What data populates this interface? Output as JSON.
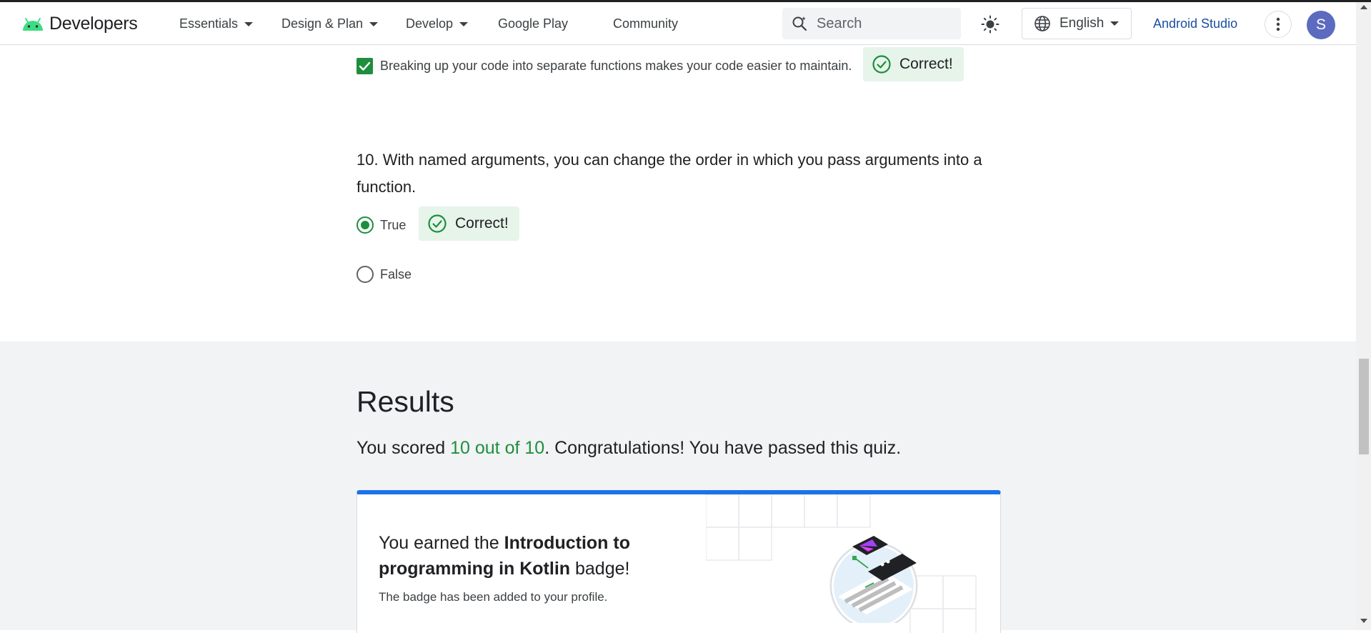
{
  "header": {
    "brand": "Developers",
    "nav": [
      {
        "label": "Essentials",
        "has_menu": true
      },
      {
        "label": "Design & Plan",
        "has_menu": true
      },
      {
        "label": "Develop",
        "has_menu": true
      },
      {
        "label": "Google Play",
        "has_menu": false
      },
      {
        "label": "Community",
        "has_menu": false
      }
    ],
    "search_placeholder": "Search",
    "language": "English",
    "cta": "Android Studio",
    "avatar_initial": "S"
  },
  "quiz": {
    "prev_option_text": "Breaking up your code into separate functions makes your code easier to maintain.",
    "prev_feedback": "Correct!",
    "question": {
      "number": "10.",
      "text": "With named arguments, you can change the order in which you pass arguments into a function.",
      "options": [
        {
          "label": "True",
          "selected": true,
          "feedback": "Correct!"
        },
        {
          "label": "False",
          "selected": false
        }
      ]
    }
  },
  "results": {
    "title": "Results",
    "score_prefix": "You scored ",
    "score": "10 out of 10",
    "score_suffix": ". Congratulations! You have passed this quiz.",
    "badge": {
      "earned_prefix": "You earned the ",
      "badge_name": "Introduction to programming in Kotlin",
      "earned_suffix": " badge!",
      "note": "The badge has been added to your profile."
    }
  },
  "colors": {
    "success": "#1e8e3e",
    "success_bg": "#e6f4ea",
    "link": "#1a4fa0",
    "accent": "#1a73e8",
    "avatar_bg": "#5c6bc0"
  },
  "icons": {
    "logo": "android-logo-icon",
    "search": "search-spark-icon",
    "theme": "sun-icon",
    "language": "globe-icon",
    "more": "more-vert-icon",
    "correct": "check-circle-icon"
  }
}
